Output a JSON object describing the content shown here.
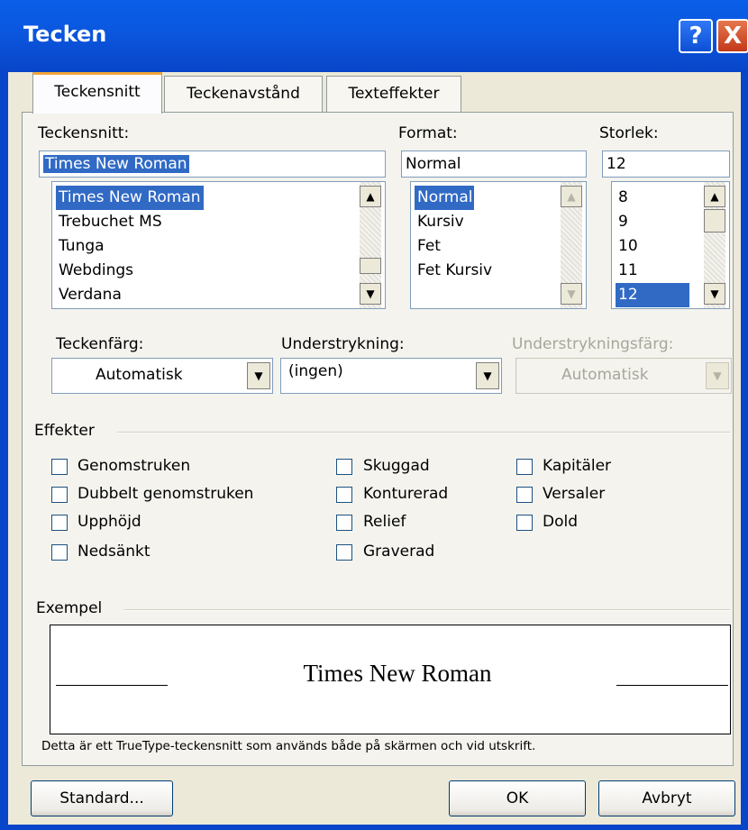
{
  "window": {
    "title": "Tecken"
  },
  "titlebar": {
    "help_glyph": "?",
    "close_glyph": "X"
  },
  "tabs": [
    {
      "label": "Teckensnitt",
      "active": true
    },
    {
      "label": "Teckenavstånd",
      "active": false
    },
    {
      "label": "Texteffekter",
      "active": false
    }
  ],
  "font": {
    "label": "Teckensnitt:",
    "value": "Times New Roman",
    "items": [
      "Times New Roman",
      "Trebuchet MS",
      "Tunga",
      "Webdings",
      "Verdana"
    ],
    "selected": "Times New Roman"
  },
  "format": {
    "label": "Format:",
    "value": "Normal",
    "items": [
      "Normal",
      "Kursiv",
      "Fet",
      "Fet Kursiv"
    ],
    "selected": "Normal"
  },
  "size": {
    "label": "Storlek:",
    "value": "12",
    "items": [
      "8",
      "9",
      "10",
      "11",
      "12"
    ],
    "selected": "12"
  },
  "font_color": {
    "label": "Teckenfärg:",
    "value": "Automatisk"
  },
  "underline": {
    "label": "Understrykning:",
    "value": "(ingen)"
  },
  "underline_color": {
    "label": "Understrykningsfärg:",
    "value": "Automatisk",
    "disabled": true
  },
  "effects": {
    "label": "Effekter",
    "col1": [
      "Genomstruken",
      "Dubbelt genomstruken",
      "Upphöjd",
      "Nedsänkt"
    ],
    "col2": [
      "Skuggad",
      "Konturerad",
      "Relief",
      "Graverad"
    ],
    "col3": [
      "Kapitäler",
      "Versaler",
      "Dold"
    ]
  },
  "preview": {
    "label": "Exempel",
    "text": "Times New Roman",
    "note": "Detta är ett TrueType-teckensnitt som används både på skärmen och vid utskrift."
  },
  "buttons": {
    "default": "Standard...",
    "ok": "OK",
    "cancel": "Avbryt"
  },
  "icons": {
    "scroll_up": "▲",
    "scroll_down": "▼",
    "dropdown": "▼"
  },
  "colors": {
    "titlebar": "#0a5ee8",
    "selection": "#316ac5",
    "dialog_bg": "#ece9d8"
  }
}
